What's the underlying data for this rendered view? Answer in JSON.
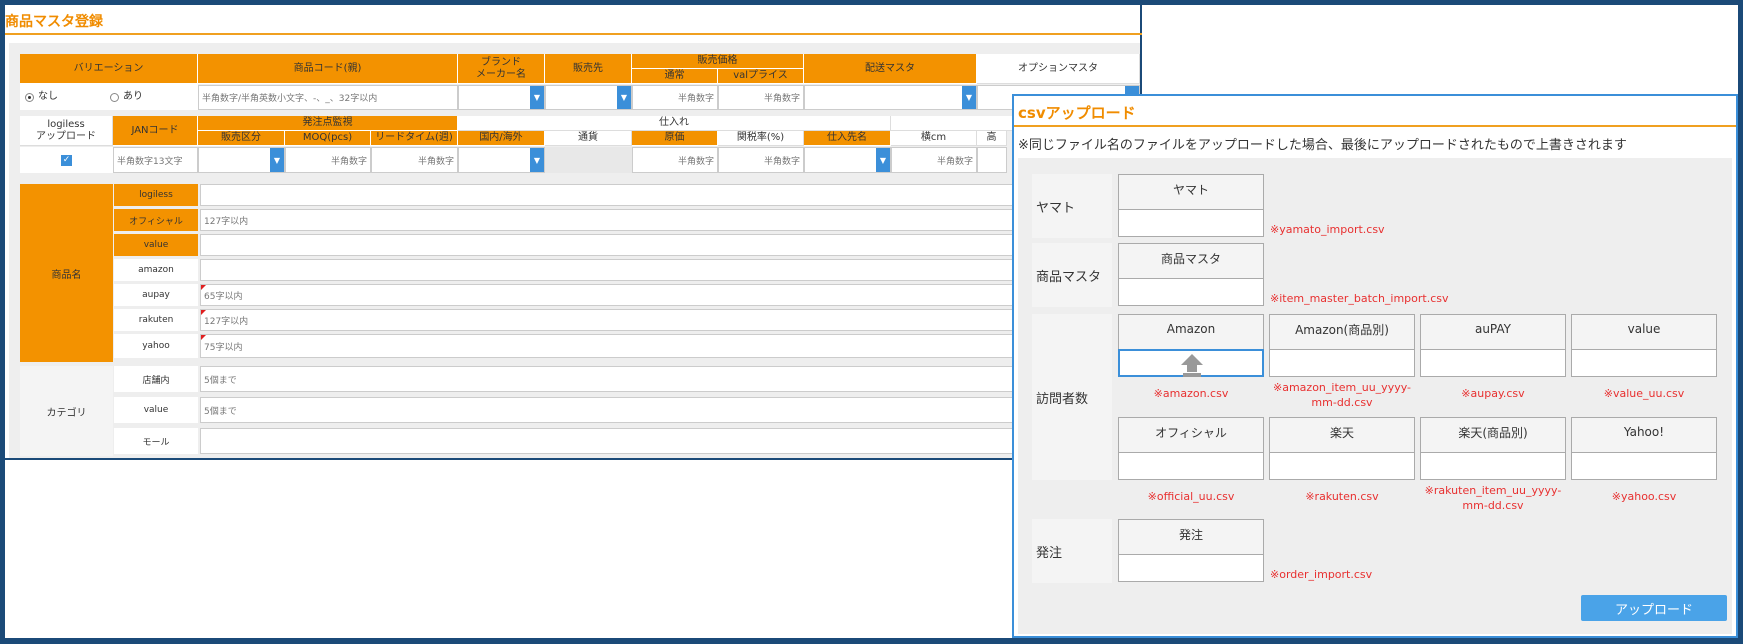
{
  "main": {
    "title": "商品マスタ登録",
    "header1": {
      "variation": "バリエーション",
      "product_code": "商品コード(親)",
      "brand": "ブランド\nメーカー名",
      "seller": "販売先",
      "sales_price": "販売価格",
      "normal": "通常",
      "valprice": "valプライス",
      "shipping_master": "配送マスタ",
      "option_master": "オプションマスタ"
    },
    "row1": {
      "radio_none": "なし",
      "radio_yes": "あり",
      "product_code_placeholder": "半角数字/半角英数小文字、-、_、32字以内",
      "normal_placeholder": "半角数字",
      "valprice_placeholder": "半角数字"
    },
    "header2": {
      "logiless_upload": "logiless\nアップロード",
      "jan_code": "JANコード",
      "order_monitor": "発注点監視",
      "sales_class": "販売区分",
      "moq": "MOQ(pcs)",
      "lead_time": "リードタイム(週)",
      "purchase": "仕入れ",
      "domestic": "国内/海外",
      "currency": "通貨",
      "unit_price": "原価",
      "customs": "関税率(%)",
      "supplier": "仕入先名",
      "width": "横cm",
      "height_cut": "高"
    },
    "row2": {
      "jan_placeholder": "半角数字13文字",
      "moq_placeholder": "半角数字",
      "lead_placeholder": "半角数字",
      "unit_price_placeholder": "半角数字",
      "customs_placeholder": "半角数字",
      "width_placeholder": "半角数字"
    },
    "product_name": {
      "label": "商品名",
      "rows": [
        {
          "label": "logiless",
          "placeholder": ""
        },
        {
          "label": "オフィシャル",
          "placeholder": "127字以内"
        },
        {
          "label": "value",
          "placeholder": ""
        },
        {
          "label": "amazon",
          "placeholder": ""
        },
        {
          "label": "aupay",
          "placeholder": "65字以内"
        },
        {
          "label": "rakuten",
          "placeholder": "127字以内"
        },
        {
          "label": "yahoo",
          "placeholder": "75字以内"
        }
      ]
    },
    "category": {
      "label": "カテゴリ",
      "rows": [
        {
          "label": "店舗内",
          "placeholder": "5個まで"
        },
        {
          "label": "value",
          "placeholder": "5個まで"
        },
        {
          "label": "モール",
          "placeholder": ""
        }
      ]
    }
  },
  "dialog": {
    "title": "csvアップロード",
    "note": "※同じファイル名のファイルをアップロードした場合、最後にアップロードされたもので上書きされます",
    "groups": {
      "yamato": {
        "label": "ヤマト",
        "box": "ヤマト",
        "file": "※yamato_import.csv"
      },
      "item_master": {
        "label": "商品マスタ",
        "box": "商品マスタ",
        "file": "※item_master_batch_import.csv"
      },
      "visitors": {
        "label": "訪問者数",
        "boxes": [
          {
            "title": "Amazon",
            "file": "※amazon.csv"
          },
          {
            "title": "Amazon(商品別)",
            "file": "※amazon_item_uu_yyyy-mm-dd.csv"
          },
          {
            "title": "auPAY",
            "file": "※aupay.csv"
          },
          {
            "title": "value",
            "file": "※value_uu.csv"
          },
          {
            "title": "オフィシャル",
            "file": "※official_uu.csv"
          },
          {
            "title": "楽天",
            "file": "※rakuten.csv"
          },
          {
            "title": "楽天(商品別)",
            "file": "※rakuten_item_uu_yyyy-mm-dd.csv"
          },
          {
            "title": "Yahoo!",
            "file": "※yahoo.csv"
          }
        ]
      },
      "order": {
        "label": "発注",
        "box": "発注",
        "file": "※order_import.csv"
      }
    },
    "upload_button": "アップロード"
  },
  "colors": {
    "accent": "#f39200",
    "title": "#f08c00",
    "button": "#4aa3e8",
    "file_note": "#e83030",
    "border_blue": "#1b4a78"
  }
}
